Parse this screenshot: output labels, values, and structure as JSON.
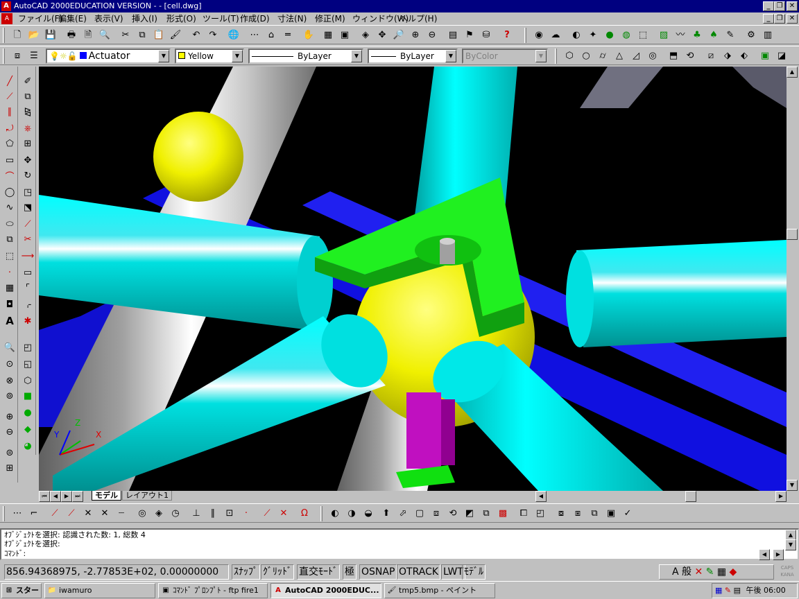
{
  "title": "AutoCAD 2000EDUCATION VERSION - - [cell.dwg]",
  "menu": [
    "ファイル(F)",
    "編集(E)",
    "表示(V)",
    "挿入(I)",
    "形式(O)",
    "ツール(T)",
    "作成(D)",
    "寸法(N)",
    "修正(M)",
    "ウィンドウ(W)",
    "ヘルプ(H)"
  ],
  "properties": {
    "layer": "Actuator",
    "color": "Yellow",
    "linetype": "ByLayer",
    "lineweight": "ByLayer",
    "plotstyle": "ByColor"
  },
  "layout_tabs": [
    "モデル",
    "レイアウト1"
  ],
  "command_lines": [
    "ｵﾌﾞｼﾞｪｸﾄを選択: 認識された数: 1, 総数 4",
    "ｵﾌﾞｼﾞｪｸﾄを選択:",
    "ｺﾏﾝﾄﾞ:"
  ],
  "coordinates": "856.94368975, -2.77853E+02, 0.00000000",
  "status_toggles": [
    "ｽﾅｯﾌﾟ",
    "ｸﾞﾘｯﾄﾞ",
    "直交ﾓｰﾄﾞ",
    "極",
    "OSNAP",
    "OTRACK",
    "LWT",
    "ﾓﾃﾞﾙ"
  ],
  "ime": [
    "A",
    "般"
  ],
  "ucs": {
    "x": "X",
    "y": "Y",
    "z": "Z"
  },
  "taskbar": {
    "start": "スタート",
    "tasks": [
      "iwamuro",
      "ｺﾏﾝﾄﾞ ﾌﾟﾛﾝﾌﾟﾄ - ftp fire1",
      "AutoCAD 2000EDUC...",
      "tmp5.bmp - ペイント"
    ],
    "clock": "午後 06:00",
    "caps": "CAPS",
    "kana": "KANA"
  },
  "colors": {
    "title_bg": "#000080",
    "viewport_bg": "#000000",
    "cyan": "#00e0e0",
    "blue": "#1010e0",
    "yellow": "#f0f000",
    "green": "#10e010",
    "magenta": "#c010c0"
  }
}
